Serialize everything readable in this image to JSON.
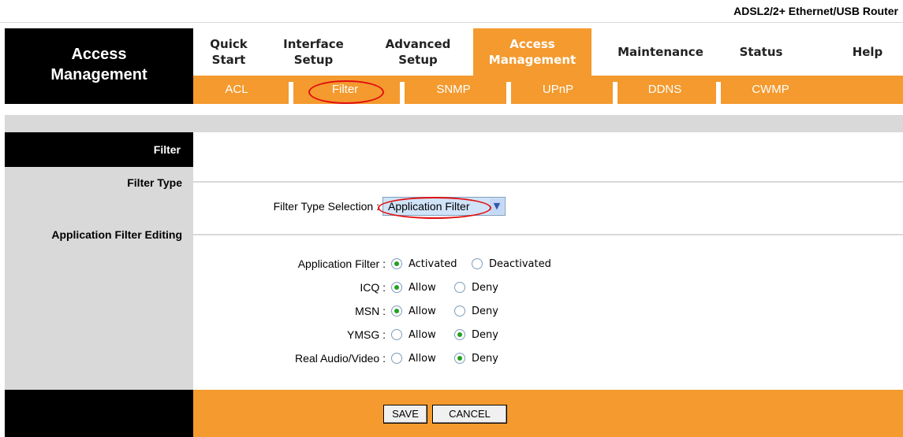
{
  "product_name": "ADSL2/2+ Ethernet/USB Router",
  "sidebar": {
    "title_line1": "Access",
    "title_line2": "Management"
  },
  "top_nav": [
    {
      "line1": "Quick",
      "line2": "Start"
    },
    {
      "line1": "Interface",
      "line2": "Setup"
    },
    {
      "line1": "Advanced",
      "line2": "Setup"
    },
    {
      "line1": "Access",
      "line2": "Management"
    },
    {
      "line1": "Maintenance",
      "line2": ""
    },
    {
      "line1": "Status",
      "line2": ""
    },
    {
      "line1": "Help",
      "line2": ""
    }
  ],
  "active_top_nav": "Access Management",
  "sub_nav": [
    "ACL",
    "Filter",
    "SNMP",
    "UPnP",
    "DDNS",
    "CWMP"
  ],
  "active_sub_nav": "Filter",
  "sections": {
    "filter": "Filter",
    "filter_type": "Filter Type",
    "app_filter_editing": "Application Filter Editing"
  },
  "filter_type_selection": {
    "label": "Filter Type Selection :",
    "value": "Application Filter"
  },
  "app_filter_rows": [
    {
      "label": "Application Filter :",
      "options": [
        "Activated",
        "Deactivated"
      ],
      "selected": 0
    },
    {
      "label": "ICQ :",
      "options": [
        "Allow",
        "Deny"
      ],
      "selected": 0
    },
    {
      "label": "MSN :",
      "options": [
        "Allow",
        "Deny"
      ],
      "selected": 0
    },
    {
      "label": "YMSG :",
      "options": [
        "Allow",
        "Deny"
      ],
      "selected": 1
    },
    {
      "label": "Real Audio/Video :",
      "options": [
        "Allow",
        "Deny"
      ],
      "selected": 1
    }
  ],
  "buttons": {
    "save": "SAVE",
    "cancel": "CANCEL"
  },
  "colors": {
    "accent": "#f49a2e",
    "black": "#000000",
    "gray": "#d9d9d9",
    "annotation_red": "#e01010"
  }
}
